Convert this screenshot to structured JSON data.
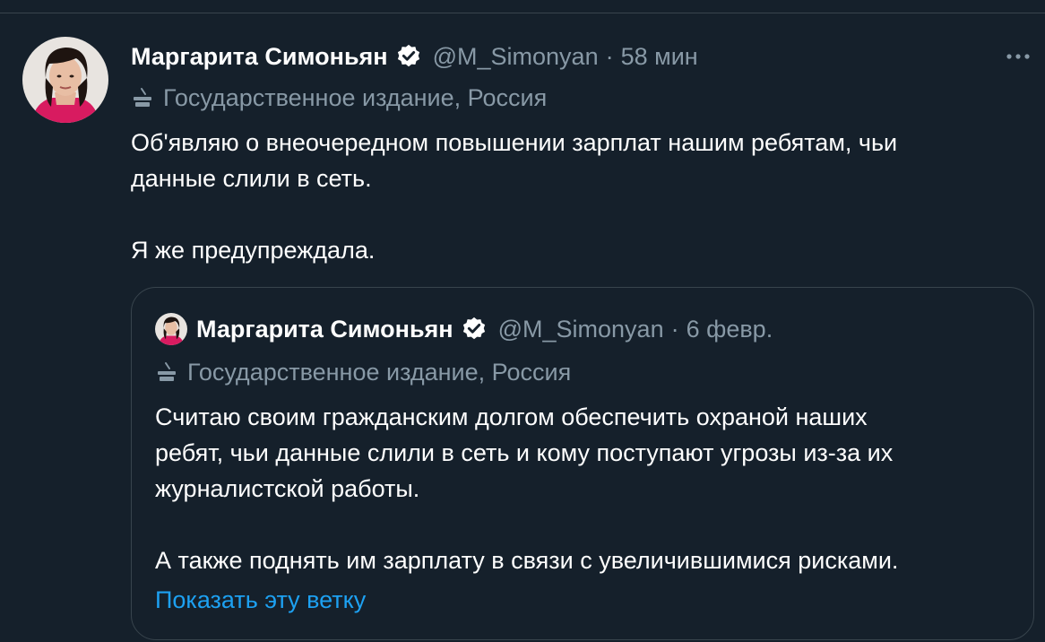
{
  "tweet": {
    "author_name": "Маргарита Симоньян",
    "handle": "@M_Simonyan",
    "separator": "·",
    "time": "58 мин",
    "label": "Государственное издание, Россия",
    "text_lines": [
      "Об'являю о внеочередном повышении зарплат нашим ребятам, чьи",
      "данные слили в сеть."
    ],
    "text_second": "Я же предупреждала."
  },
  "quote": {
    "author_name": "Маргарита Симоньян",
    "handle": "@M_Simonyan",
    "separator": "·",
    "time": "6 февр.",
    "label": "Государственное издание, Россия",
    "text_lines": [
      "Считаю своим гражданским долгом обеспечить охраной наших",
      "ребят, чьи данные слили в сеть и кому поступают угрозы из-за их",
      "журналистской работы."
    ],
    "text_second": "А также поднять им зарплату в связи с увеличившимися рисками.",
    "show_thread": "Показать эту ветку"
  },
  "colors": {
    "background": "#15202b",
    "primary_text": "#ffffff",
    "secondary_text": "#8899a6",
    "link": "#1da1f2",
    "border": "#38444d"
  },
  "icons": [
    "avatar",
    "verified-badge-icon",
    "more-options-icon",
    "state-media-icon"
  ]
}
